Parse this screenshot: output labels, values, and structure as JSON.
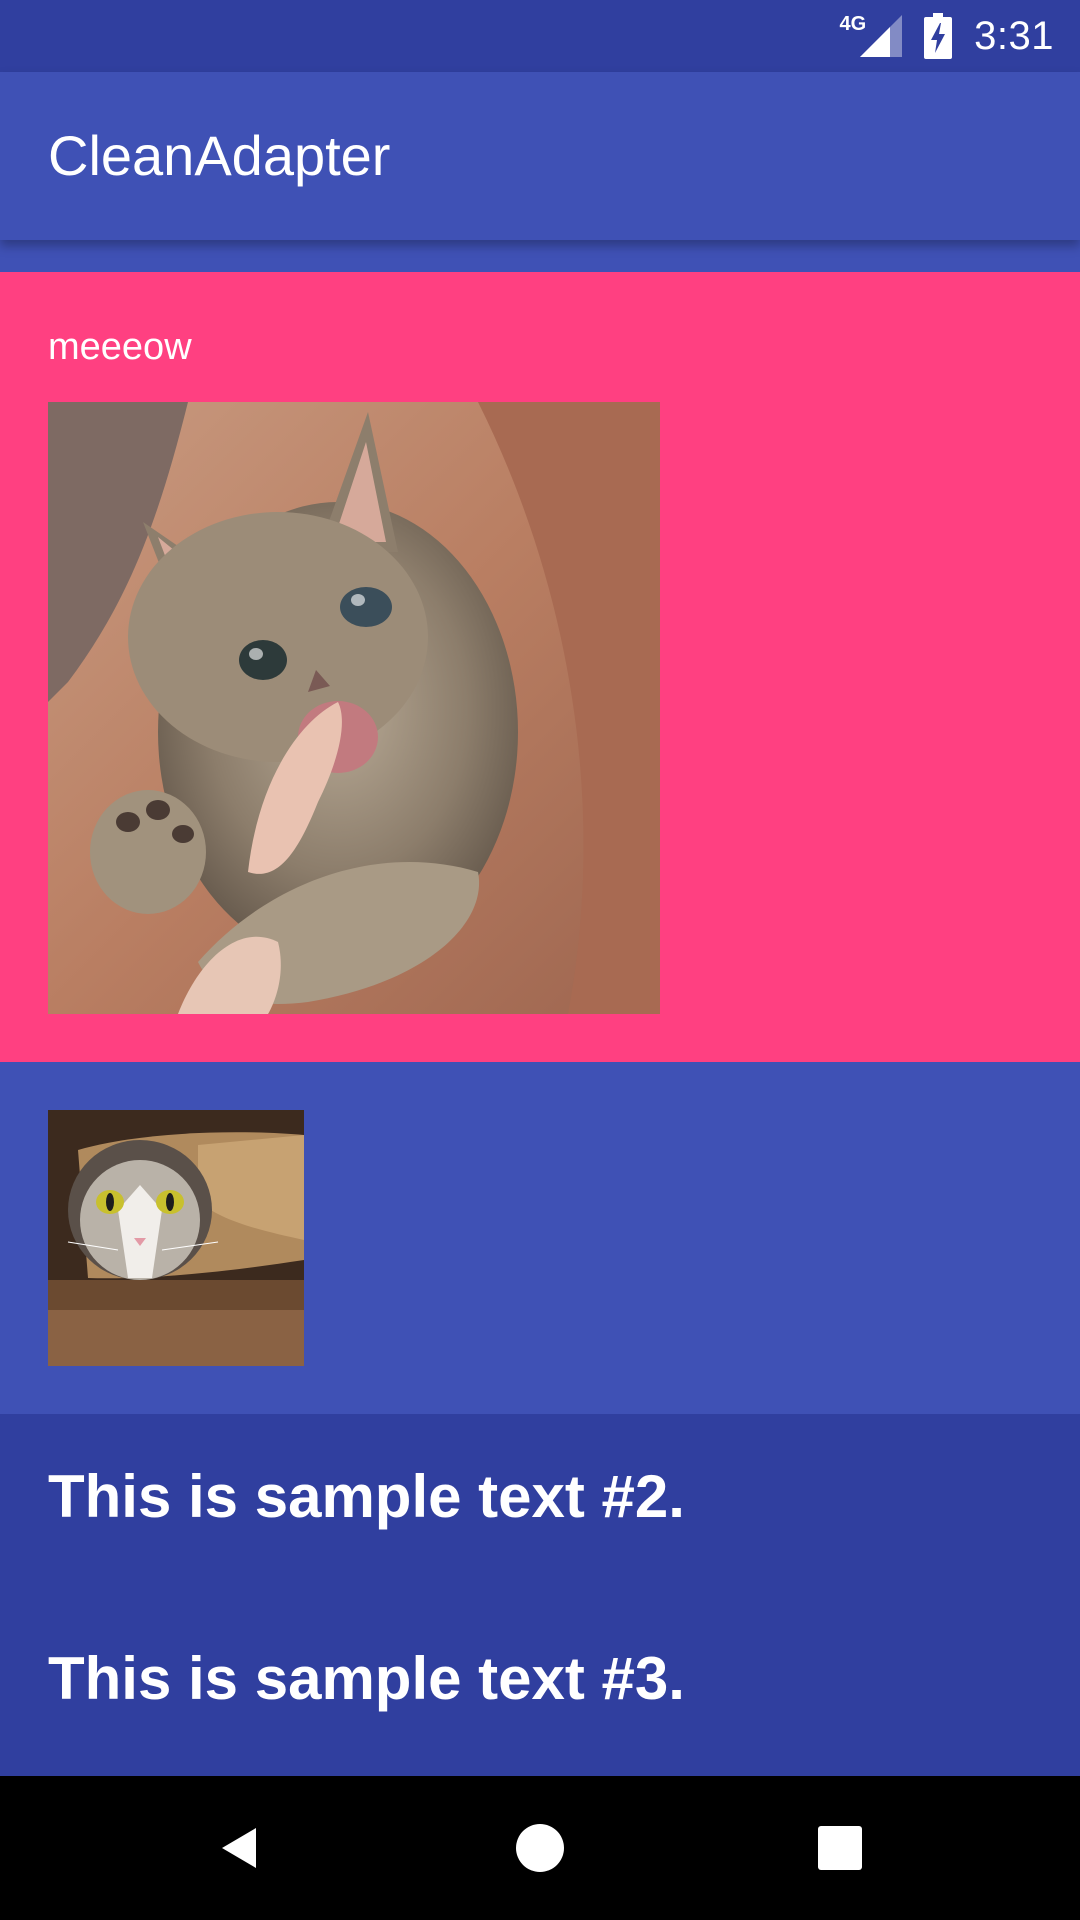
{
  "status_bar": {
    "network": "4G",
    "time": "3:31",
    "icons": [
      "signal-icon",
      "battery-charging-icon"
    ]
  },
  "toolbar": {
    "title": "CleanAdapter"
  },
  "list": {
    "item1": {
      "caption": "meeeow",
      "image": "kitten-biting-finger-photo",
      "background": "#ff4081"
    },
    "item2": {
      "image": "cat-in-paper-bag-photo",
      "background": "#3f51b5"
    },
    "item3": {
      "text": "This is sample text #2.",
      "background": "#303f9f"
    },
    "item4": {
      "text": "This is sample text #3.",
      "background": "#303f9f"
    }
  },
  "nav_bar": {
    "icons": [
      "back-icon",
      "home-icon",
      "recents-icon"
    ]
  },
  "colors": {
    "primary": "#3f51b5",
    "primary_dark": "#303f9f",
    "accent": "#ff4081"
  }
}
